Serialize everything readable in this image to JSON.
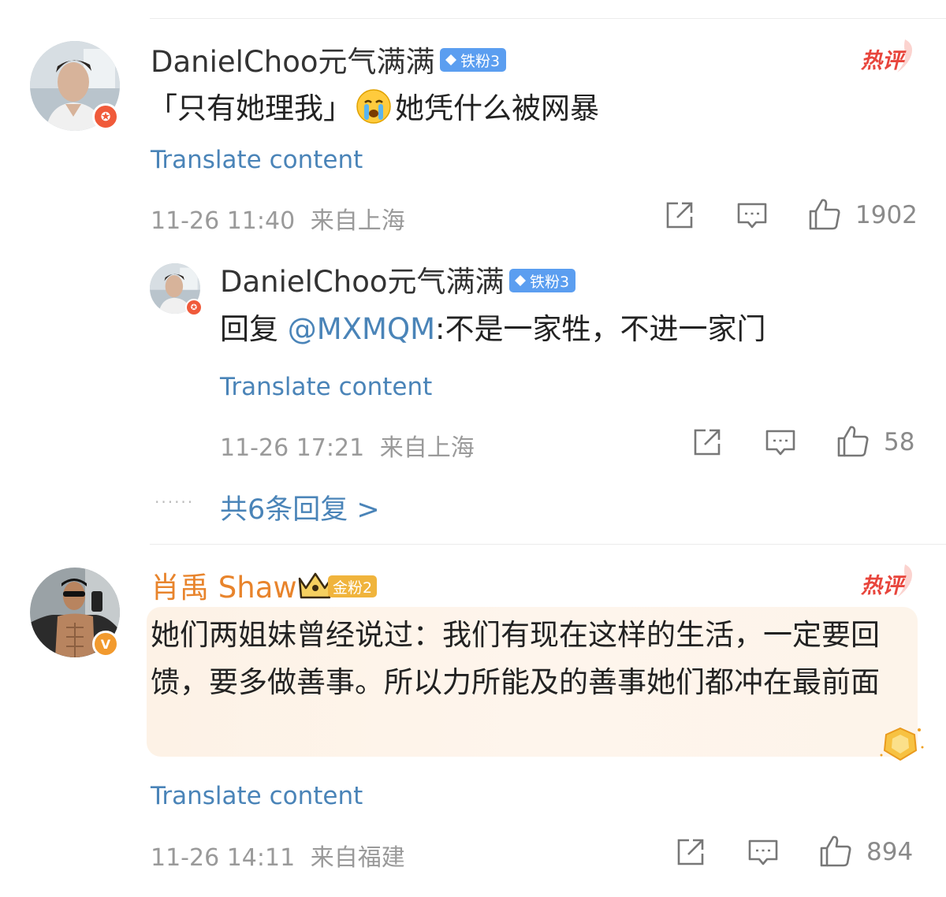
{
  "comments": [
    {
      "username": "DanielChoo元气满满",
      "badge": "铁粉3",
      "badge_color": "#5b9ef0",
      "hot_label": "热评",
      "text_parts": [
        "「只有她理我」",
        "她凭什么被网暴"
      ],
      "emoji": "crying-face",
      "translate": "Translate content",
      "time": "11-26 11:40",
      "location": "来自上海",
      "likes": "1902",
      "reply": {
        "username": "DanielChoo元气满满",
        "badge": "铁粉3",
        "prefix": "回复 ",
        "mention": "@MXMQM",
        "text": ":不是一家牲，不进一家门",
        "translate": "Translate content",
        "time": "11-26 17:21",
        "location": "来自上海",
        "likes": "58"
      },
      "more_replies": "共6条回复 >"
    },
    {
      "username": "肖禹 Shaw",
      "username_color": "#e8842c",
      "badge": "金粉2",
      "badge_color": "#f0b43c",
      "hot_label": "热评",
      "text": "她们两姐妹曾经说过：我们有现在这样的生活，一定要回馈，要多做善事。所以力所能及的善事她们都冲在最前面",
      "translate": "Translate content",
      "time": "11-26 14:11",
      "location": "来自福建",
      "likes": "894"
    }
  ]
}
